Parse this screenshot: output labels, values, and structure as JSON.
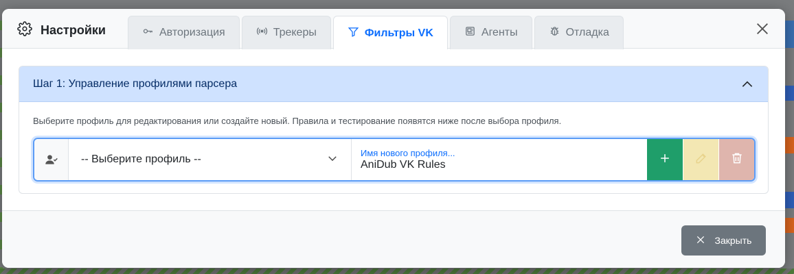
{
  "modal": {
    "title": "Настройки",
    "tabs": [
      {
        "label": "Авторизация",
        "icon": "key-icon",
        "active": false
      },
      {
        "label": "Трекеры",
        "icon": "broadcast-icon",
        "active": false
      },
      {
        "label": "Фильтры VK",
        "icon": "filter-icon",
        "active": true
      },
      {
        "label": "Агенты",
        "icon": "agent-icon",
        "active": false
      },
      {
        "label": "Отладка",
        "icon": "bug-icon",
        "active": false
      }
    ]
  },
  "step": {
    "header": "Шаг 1: Управление профилями парсера",
    "description": "Выберите профиль для редактирования или создайте новый. Правила и тестирование появятся ниже после выбора профиля.",
    "select_value": "-- Выберите профиль --",
    "new_profile_label": "Имя нового профиля...",
    "new_profile_value": "AniDub VK Rules"
  },
  "footer": {
    "close_label": "Закрыть"
  },
  "colors": {
    "accent": "#0d6efd",
    "add": "#1f9e6a",
    "edit": "#f3e7b3",
    "delete": "#dfb5ad",
    "close": "#6c757d"
  }
}
